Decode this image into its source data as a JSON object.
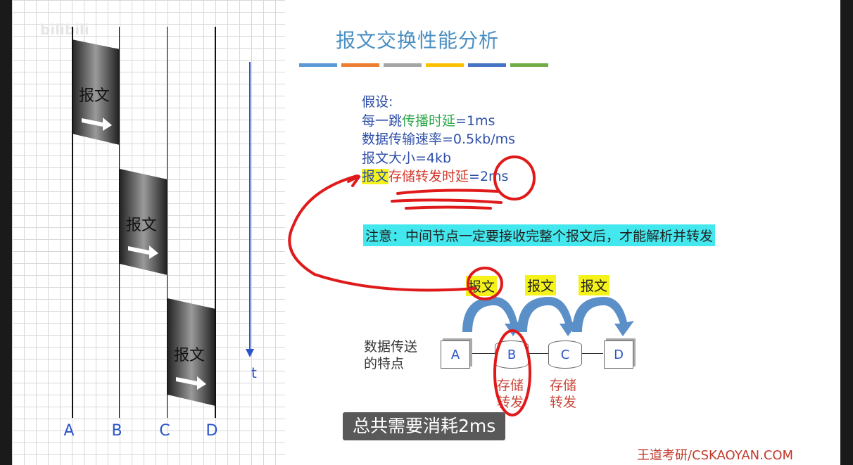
{
  "watermark": "bilibili",
  "left_diagram": {
    "nodes": [
      "A",
      "B",
      "C",
      "D"
    ],
    "message_label": "报文",
    "time_axis_label": "t"
  },
  "slide": {
    "title": "报文交换性能分析",
    "title_bar_colors": [
      "#5b9bd5",
      "#ed7d31",
      "#a5a5a5",
      "#ffc000",
      "#4472c4",
      "#70ad47"
    ],
    "assumptions": {
      "heading": "假设:",
      "line1_prefix": "每一跳",
      "line1_highlight": "传播时延",
      "line1_suffix": "=1ms",
      "line2": "数据传输速率=0.5kb/ms",
      "line3": "报文大小=4kb",
      "line4_highlight": "报文",
      "line4_red": "存储转发时延",
      "line4_suffix": "=2ms"
    },
    "note": "注意：中间节点一定要接收完整个报文后，才能解析并转发",
    "bottom_diagram": {
      "caption_line1": "数据传送",
      "caption_line2": "的特点",
      "tag": "报文",
      "nodes": [
        "A",
        "B",
        "C",
        "D"
      ],
      "store_forward_line1": "存储",
      "store_forward_line2": "转发"
    }
  },
  "subtitle": "总共需要消耗2ms",
  "footer": "王道考研/CSKAOYAN.COM"
}
